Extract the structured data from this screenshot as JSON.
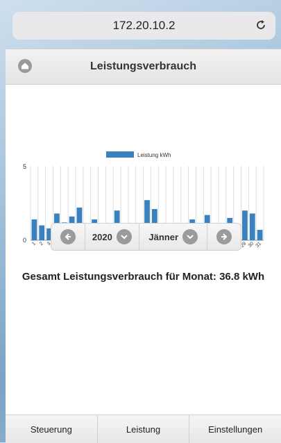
{
  "browser": {
    "url": "172.20.10.2"
  },
  "header": {
    "title": "Leistungsverbrauch"
  },
  "selector": {
    "year": "2020",
    "month": "Jänner"
  },
  "summary": {
    "text": "Gesamt Leistungsverbrauch für Monat: 36.8 kWh"
  },
  "tabs": [
    {
      "label": "Steuerung"
    },
    {
      "label": "Leistung"
    },
    {
      "label": "Einstellungen"
    }
  ],
  "colors": {
    "bar": "#3a82bf",
    "grid": "#dddddd"
  },
  "chart_data": {
    "type": "bar",
    "title": "",
    "xlabel": "",
    "ylabel": "",
    "ylim": [
      0,
      5
    ],
    "y_ticks": [
      "0",
      "5"
    ],
    "grid": true,
    "legend": "top-center",
    "categories": [
      "1",
      "2",
      "3",
      "4",
      "5",
      "6",
      "7",
      "8",
      "9",
      "10",
      "11",
      "12",
      "13",
      "14",
      "15",
      "16",
      "17",
      "18",
      "19",
      "20",
      "21",
      "22",
      "23",
      "24",
      "25",
      "26",
      "27",
      "28",
      "29",
      "30",
      "31"
    ],
    "series": [
      {
        "name": "Leistung kWh",
        "values": [
          1.4,
          1.0,
          0.8,
          1.8,
          1.2,
          1.6,
          2.2,
          1.0,
          1.4,
          0.5,
          0,
          2.0,
          0.9,
          1.1,
          0.5,
          2.7,
          2.1,
          0.8,
          0,
          0,
          0.5,
          1.4,
          1.1,
          1.7,
          1.0,
          0,
          1.5,
          1.1,
          2.0,
          1.8,
          0.7
        ]
      }
    ]
  }
}
